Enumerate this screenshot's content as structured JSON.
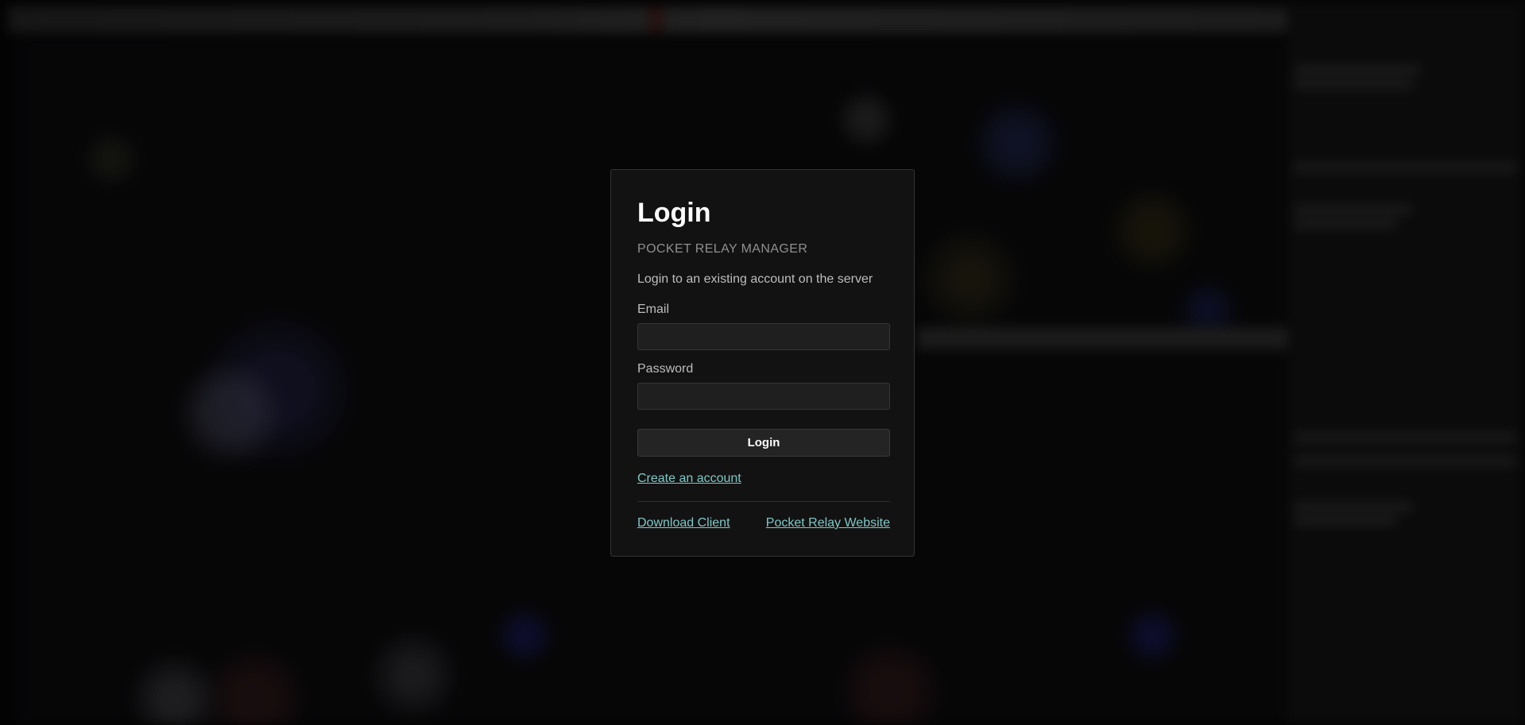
{
  "login": {
    "title": "Login",
    "app_name": "POCKET RELAY MANAGER",
    "description": "Login to an existing account on the server",
    "email_label": "Email",
    "email_value": "",
    "password_label": "Password",
    "password_value": "",
    "submit_label": "Login",
    "create_account_link": "Create an account",
    "download_client_link": "Download Client",
    "website_link": "Pocket Relay Website"
  },
  "colors": {
    "card_background": "#121212",
    "link": "#7ec8c6",
    "title": "#ffffff"
  }
}
